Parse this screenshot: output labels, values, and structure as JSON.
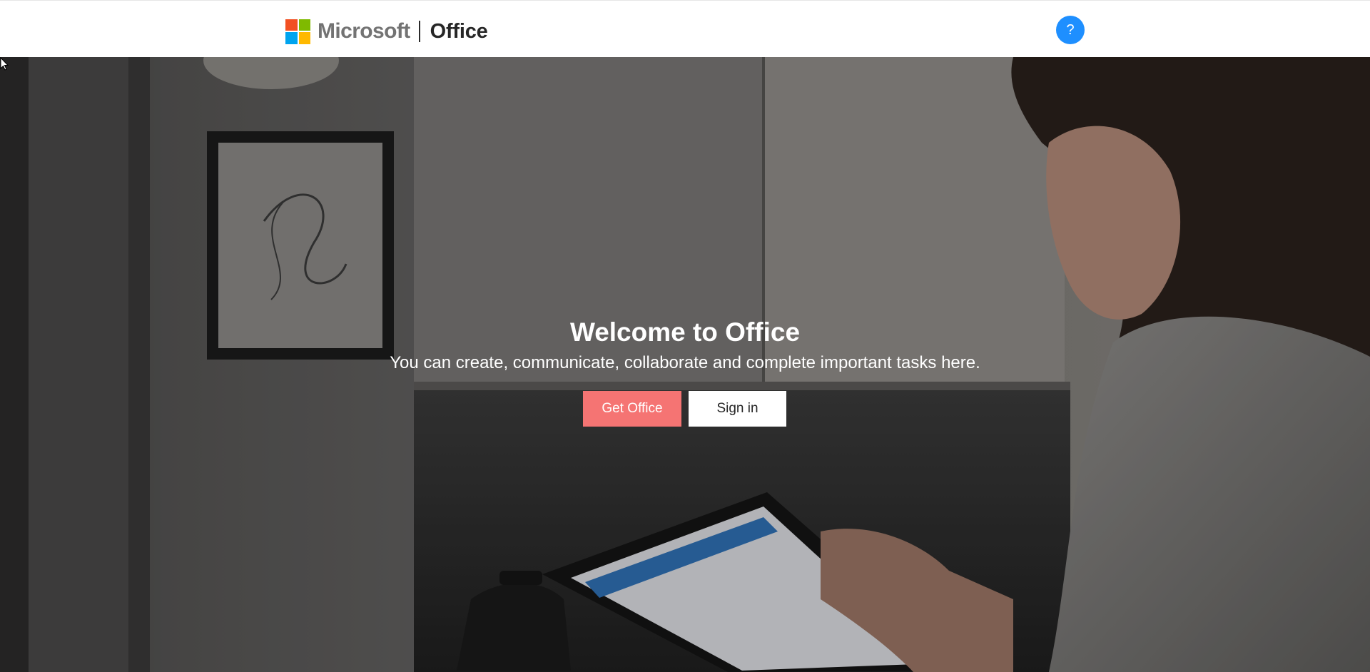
{
  "header": {
    "brand_company": "Microsoft",
    "brand_product": "Office",
    "help_label": "?",
    "logo_colors": [
      "#f25022",
      "#7fba00",
      "#00a4ef",
      "#ffb900"
    ]
  },
  "hero": {
    "title": "Welcome to Office",
    "subtitle": "You can create, communicate, collaborate and complete important tasks here.",
    "get_office_label": "Get Office",
    "sign_in_label": "Sign in"
  },
  "colors": {
    "accent_button": "#f57473",
    "help_button": "#1e8fff"
  }
}
